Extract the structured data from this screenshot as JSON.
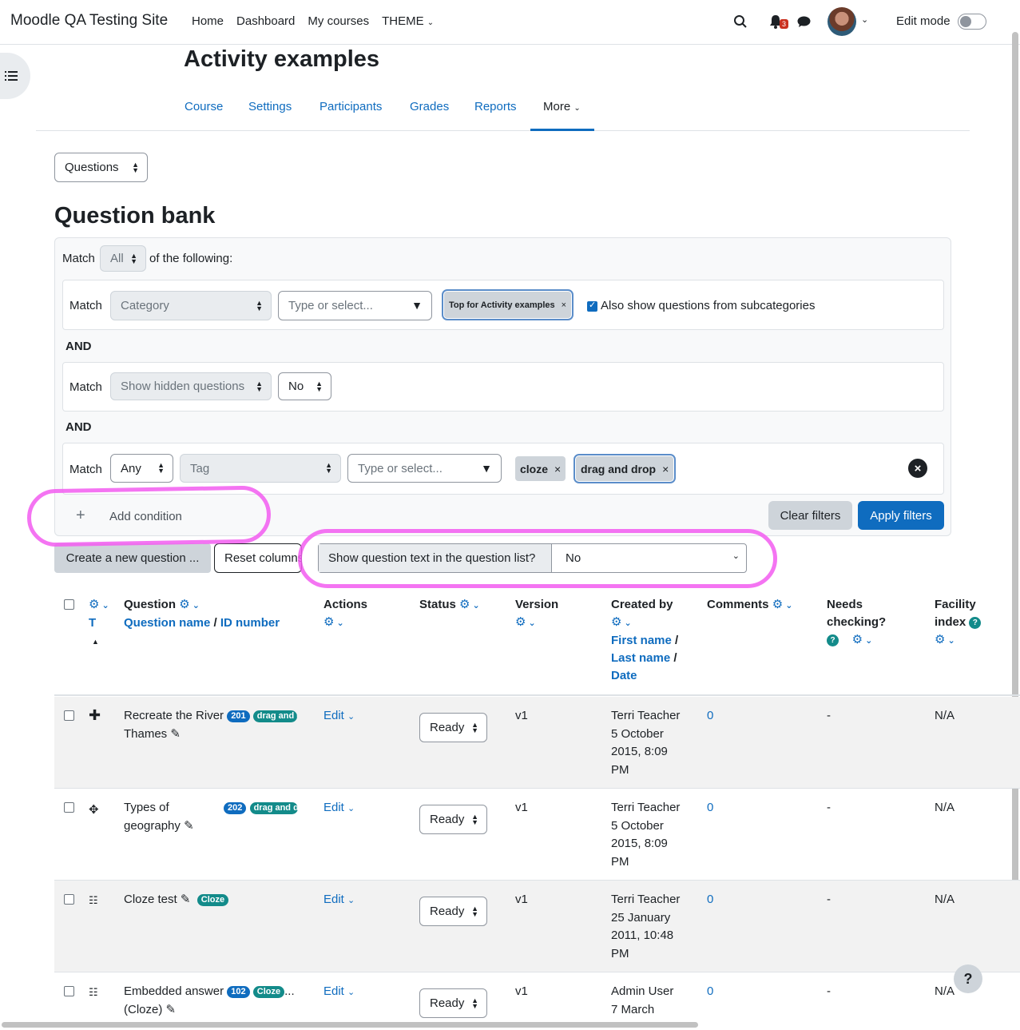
{
  "site_name": "Moodle QA Testing Site",
  "primary_nav": [
    "Home",
    "Dashboard",
    "My courses",
    "THEME"
  ],
  "notifications_count": "3",
  "edit_mode_label": "Edit mode",
  "page_title": "Activity examples",
  "secondary_nav": {
    "course": "Course",
    "settings": "Settings",
    "participants": "Participants",
    "grades": "Grades",
    "reports": "Reports",
    "more": "More"
  },
  "questions_select": "Questions",
  "qbank_title": "Question bank",
  "filters": {
    "match_label": "Match",
    "match_all": "All",
    "of_following": "of the following:",
    "and_label": "AND",
    "category_select": "Category",
    "type_placeholder": "Type or select...",
    "category_chip": "Top for Activity examples",
    "subcategories_label": "Also show questions from subcategories",
    "hidden_select": "Show hidden questions",
    "hidden_value": "No",
    "tag_match": "Any",
    "tag_select": "Tag",
    "tag_chips": [
      "cloze",
      "drag and drop"
    ],
    "add_condition": "Add condition",
    "clear_filters": "Clear filters",
    "apply_filters": "Apply filters"
  },
  "toolbar": {
    "create_question": "Create a new question ...",
    "reset_columns": "Reset columns",
    "show_text_label": "Show question text in the question list?",
    "show_text_value": "No"
  },
  "table": {
    "headers": {
      "t": "T",
      "question": "Question",
      "question_name": "Question name",
      "id_number": "ID number",
      "actions": "Actions",
      "status": "Status",
      "version": "Version",
      "created_by": "Created by",
      "first_name": "First name",
      "last_name": "Last name",
      "date": "Date",
      "comments": "Comments",
      "needs_checking": "Needs checking?",
      "facility_index": "Facility index"
    },
    "rows": [
      {
        "name_l1": "Recreate the River",
        "name_l2": "Thames",
        "id": "201",
        "tag": "drag and drop",
        "action": "Edit",
        "status": "Ready",
        "version": "v1",
        "creator": "Terri Teacher",
        "date_l1": "5 October",
        "date_l2": "2015, 8:09",
        "date_l3": "PM",
        "comments": "0",
        "needs": "-",
        "facility": "N/A"
      },
      {
        "name_l1": "Types of",
        "name_l2": "geography",
        "id": "202",
        "tag": "drag and drop",
        "action": "Edit",
        "status": "Ready",
        "version": "v1",
        "creator": "Terri Teacher",
        "date_l1": "5 October",
        "date_l2": "2015, 8:09",
        "date_l3": "PM",
        "comments": "0",
        "needs": "-",
        "facility": "N/A"
      },
      {
        "name_l1": "Cloze test",
        "name_l2": "",
        "id": "",
        "tag": "Cloze",
        "action": "Edit",
        "status": "Ready",
        "version": "v1",
        "creator": "Terri Teacher",
        "date_l1": "25 January",
        "date_l2": "2011, 10:48",
        "date_l3": "PM",
        "comments": "0",
        "needs": "-",
        "facility": "N/A"
      },
      {
        "name_l1": "Embedded answer",
        "name_l2": "(Cloze)",
        "id": "102",
        "tag": "Cloze",
        "action": "Edit",
        "status": "Ready",
        "version": "v1",
        "creator": "Admin User",
        "date_l1": "7 March",
        "date_l2": "",
        "date_l3": "",
        "comments": "0",
        "needs": "-",
        "facility": "N/A"
      }
    ]
  },
  "help_button": "?"
}
